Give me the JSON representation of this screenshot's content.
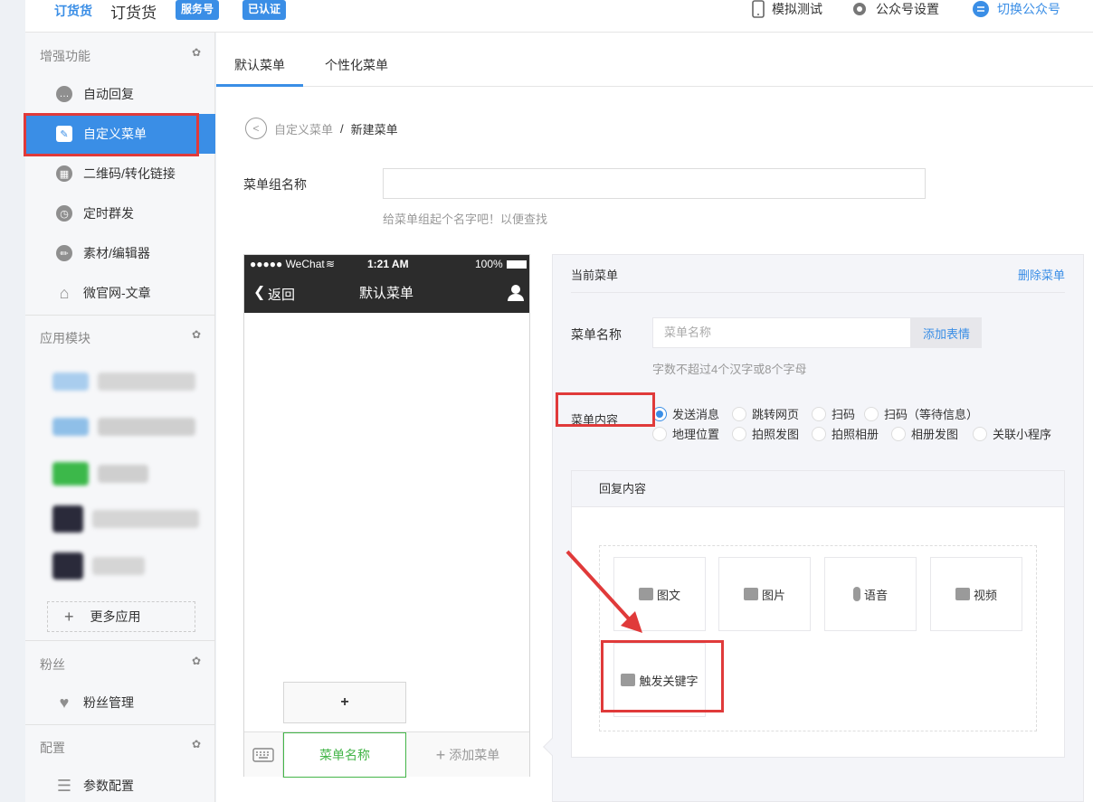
{
  "topbar": {
    "logo": "订货货",
    "account_name": "订货货",
    "badge_service": "服务号",
    "badge_verified": "已认证",
    "simulate_label": "模拟测试",
    "settings_label": "公众号设置",
    "switch_label": "切换公众号"
  },
  "sidebar": {
    "sections": [
      {
        "title": "增强功能"
      },
      {
        "title": "应用模块"
      },
      {
        "title": "粉丝"
      },
      {
        "title": "配置"
      }
    ],
    "items": [
      {
        "label": "自动回复",
        "icon": "chat-icon"
      },
      {
        "label": "自定义菜单",
        "icon": "edit-doc-icon"
      },
      {
        "label": "二维码/转化链接",
        "icon": "qrcode-icon"
      },
      {
        "label": "定时群发",
        "icon": "clock-icon"
      },
      {
        "label": "素材/编辑器",
        "icon": "pencil-icon"
      },
      {
        "label": "微官网-文章",
        "icon": "home-icon"
      }
    ],
    "more_apps": "更多应用",
    "fans_item": "粉丝管理",
    "config_item": "参数配置"
  },
  "main": {
    "tabs": [
      {
        "label": "默认菜单"
      },
      {
        "label": "个性化菜单"
      }
    ],
    "breadcrumb": {
      "parent": "自定义菜单",
      "sep": "/",
      "current": "新建菜单"
    },
    "group_name_label": "菜单组名称",
    "group_name_value": "",
    "group_name_hint": "给菜单组起个名字吧！以便查找"
  },
  "phone": {
    "carrier": "●●●●● WeChat",
    "time": "1:21 AM",
    "battery": "100%",
    "back_label": "返回",
    "title": "默认菜单",
    "sub_add": "+",
    "menu_item": "菜单名称",
    "add_menu": "添加菜单"
  },
  "editor": {
    "current_menu": "当前菜单",
    "delete_menu": "删除菜单",
    "name_label": "菜单名称",
    "name_placeholder": "菜单名称",
    "emoji_button": "添加表情",
    "name_hint": "字数不超过4个汉字或8个字母",
    "content_label": "菜单内容",
    "options_row1": [
      "发送消息",
      "跳转网页",
      "扫码",
      "扫码（等待信息）"
    ],
    "options_row2": [
      "地理位置",
      "拍照发图",
      "拍照相册",
      "相册发图",
      "关联小程序"
    ],
    "selected_option": "发送消息",
    "reply_title": "回复内容",
    "reply_types": [
      "图文",
      "图片",
      "语音",
      "视频"
    ],
    "keyword_trigger": "触发关键字"
  },
  "colors": {
    "accent": "#3a8ee6",
    "green": "#44b549",
    "annotation_red": "#e03a3a"
  }
}
